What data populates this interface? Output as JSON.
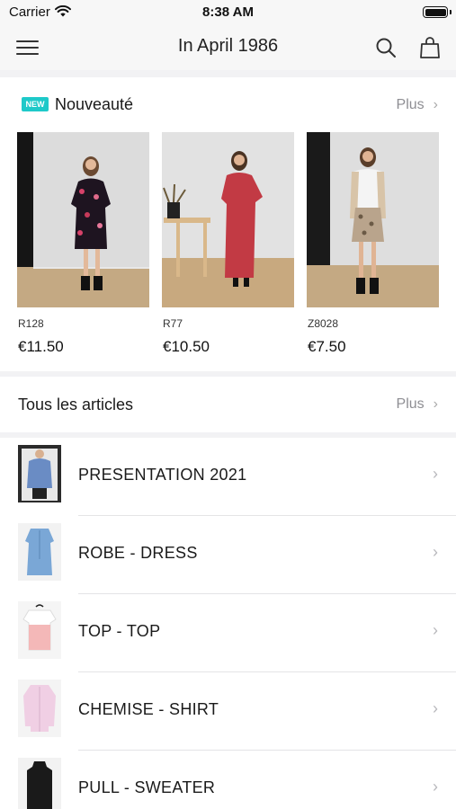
{
  "status_bar": {
    "carrier": "Carrier",
    "time": "8:38 AM"
  },
  "nav": {
    "title": "In April 1986",
    "icons": [
      "menu-icon",
      "search-icon",
      "shopping-bag-icon"
    ]
  },
  "new_section": {
    "badge": "NEW",
    "title": "Nouveauté",
    "more": "Plus",
    "products": [
      {
        "code": "R128",
        "price": "€11.50"
      },
      {
        "code": "R77",
        "price": "€10.50"
      },
      {
        "code": "Z8028",
        "price": "€7.50"
      }
    ]
  },
  "all_section": {
    "title": "Tous les articles",
    "more": "Plus"
  },
  "categories": [
    {
      "label": "PRESENTATION 2021"
    },
    {
      "label": "ROBE - DRESS"
    },
    {
      "label": "TOP - TOP"
    },
    {
      "label": "CHEMISE - SHIRT"
    },
    {
      "label": "PULL - SWEATER"
    }
  ],
  "colors": {
    "accent_badge": "#1ec9c9",
    "muted_text": "#8e8e93",
    "background": "#f2f2f4"
  }
}
